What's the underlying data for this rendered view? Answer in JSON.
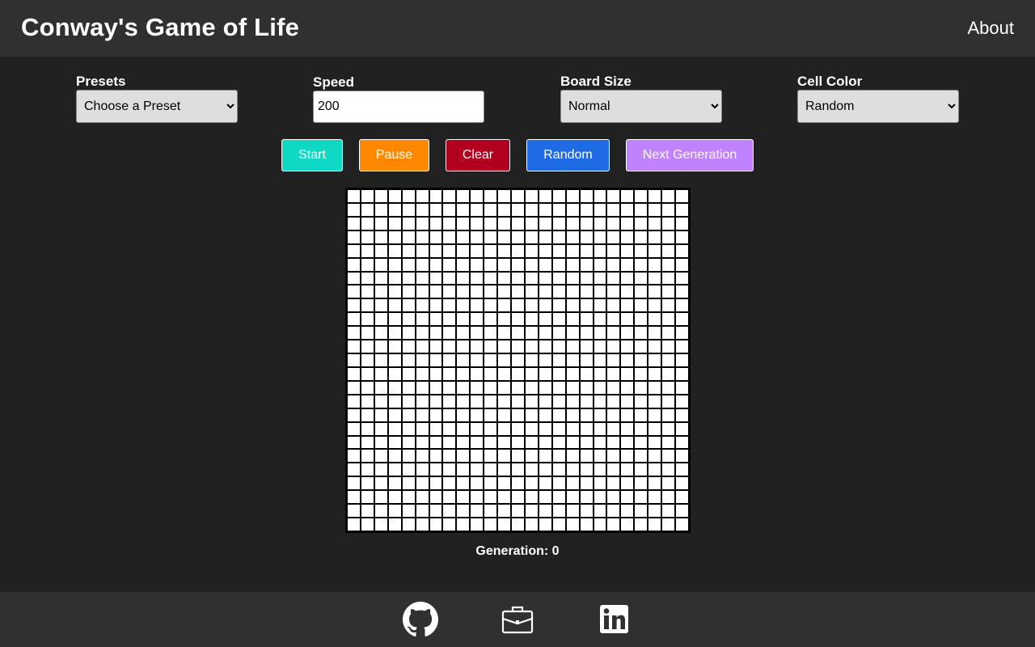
{
  "header": {
    "title": "Conway's Game of Life",
    "about_label": "About"
  },
  "controls": {
    "presets": {
      "label": "Presets",
      "selected": "Choose a Preset"
    },
    "speed": {
      "label": "Speed",
      "value": "200"
    },
    "board_size": {
      "label": "Board Size",
      "selected": "Normal"
    },
    "cell_color": {
      "label": "Cell Color",
      "selected": "Random"
    }
  },
  "buttons": {
    "start": {
      "label": "Start",
      "color": "#0fd9c5"
    },
    "pause": {
      "label": "Pause",
      "color": "#ff8800"
    },
    "clear": {
      "label": "Clear",
      "color": "#b10020"
    },
    "random": {
      "label": "Random",
      "color": "#1f6be6"
    },
    "next_generation": {
      "label": "Next Generation",
      "color": "#c082ff"
    }
  },
  "board": {
    "rows": 25,
    "cols": 25,
    "cell_color": "#ffffff",
    "grid_color": "#000000"
  },
  "status": {
    "generation_text": "Generation: 0"
  },
  "footer": {
    "icons": [
      "github-icon",
      "briefcase-icon",
      "linkedin-icon"
    ]
  },
  "colors": {
    "page_background": "#212121",
    "bar_background": "#303030"
  }
}
